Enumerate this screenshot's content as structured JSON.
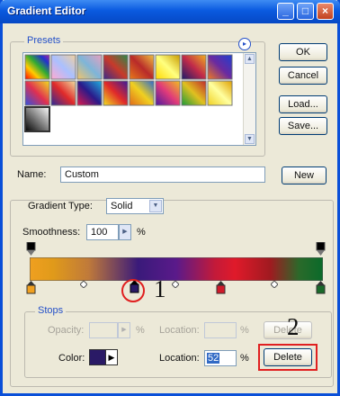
{
  "window": {
    "title": "Gradient Editor"
  },
  "titlebar": {
    "min_glyph": "_",
    "max_glyph": "□",
    "close_glyph": "×"
  },
  "presets": {
    "label": "Presets",
    "menu_glyph": "▸"
  },
  "buttons": {
    "ok": "OK",
    "cancel": "Cancel",
    "load": "Load...",
    "save": "Save...",
    "new": "New",
    "delete_disabled": "Delete",
    "delete": "Delete"
  },
  "name": {
    "label": "Name:",
    "value": "Custom"
  },
  "gradient": {
    "type_label": "Gradient Type:",
    "type_value": "Solid",
    "smoothness_label": "Smoothness:",
    "smoothness_value": "100",
    "smoothness_unit": "%"
  },
  "stops": {
    "label": "Stops",
    "opacity_label": "Opacity:",
    "opacity_unit": "%",
    "location_label": "Location:",
    "location_unit": "%",
    "color_label": "Color:",
    "color_location_label": "Location:",
    "color_location_unit": "%",
    "color_swatch": "#2a1a66",
    "location_value": "52"
  },
  "annotations": {
    "one": "1",
    "two": "2",
    "color": "#e02020"
  },
  "colors": {
    "accent": "#2450c8",
    "title": "#0a5ae0"
  }
}
